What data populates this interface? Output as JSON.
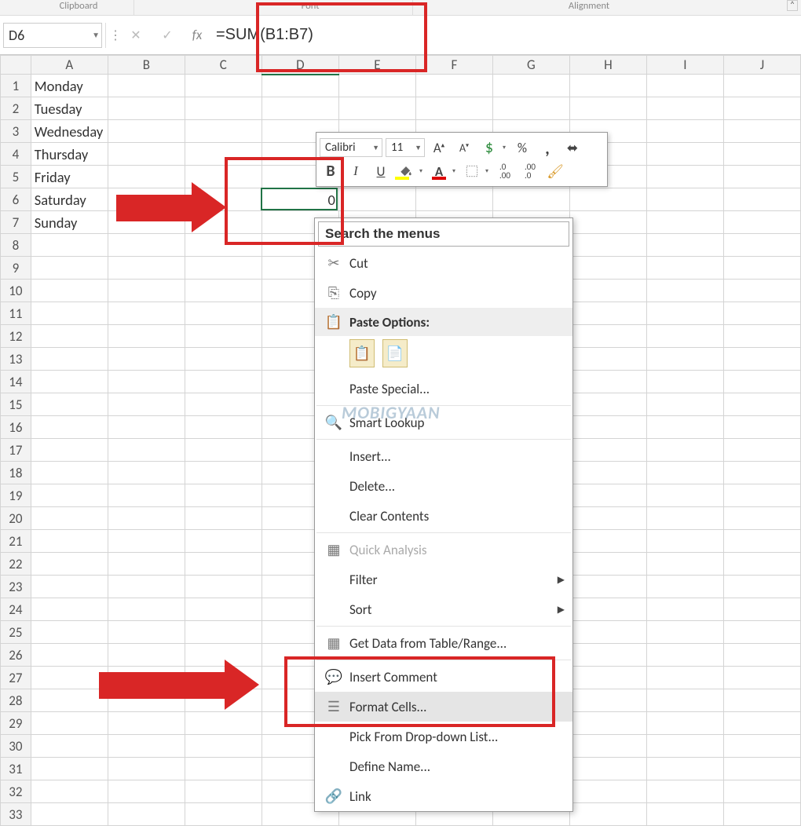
{
  "ribbon": {
    "group_clipboard": "Clipboard",
    "group_font": "Font",
    "group_alignment": "Alignment"
  },
  "formula_bar": {
    "name_box": "D6",
    "fx_label": "fx",
    "formula": "=SUM(B1:B7)"
  },
  "grid": {
    "columns": [
      "A",
      "B",
      "C",
      "D",
      "E",
      "F",
      "G",
      "H",
      "I",
      "J"
    ],
    "row_count": 33,
    "active_cell": "D6",
    "cells": {
      "A1": "Monday",
      "A2": "Tuesday",
      "A3": "Wednesday",
      "A4": "Thursday",
      "A5": "Friday",
      "A6": "Saturday",
      "A7": "Sunday",
      "D6": "0"
    }
  },
  "mini_toolbar": {
    "font_name": "Calibri",
    "font_size": "11"
  },
  "context_menu": {
    "search_placeholder": "Search the menus",
    "cut": "Cut",
    "copy": "Copy",
    "paste_options_header": "Paste Options:",
    "paste_special": "Paste Special...",
    "smart_lookup": "Smart Lookup",
    "insert": "Insert...",
    "delete": "Delete...",
    "clear_contents": "Clear Contents",
    "quick_analysis": "Quick Analysis",
    "filter": "Filter",
    "sort": "Sort",
    "get_data": "Get Data from Table/Range...",
    "insert_comment": "Insert Comment",
    "format_cells": "Format Cells...",
    "pick_list": "Pick From Drop-down List...",
    "define_name": "Define Name...",
    "link": "Link"
  },
  "watermark": "MOBIGYAAN"
}
